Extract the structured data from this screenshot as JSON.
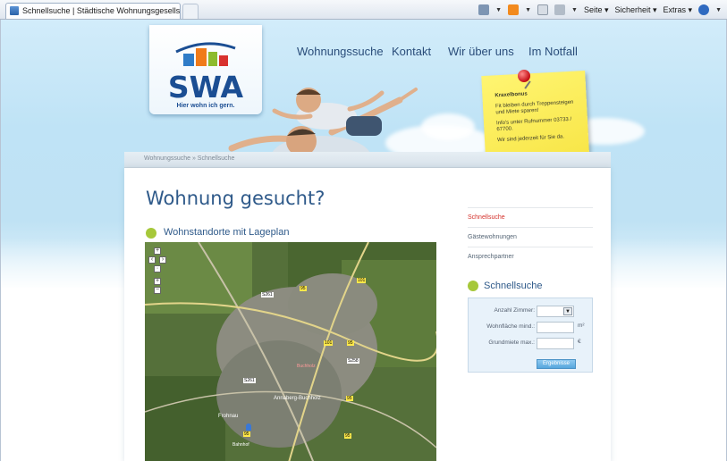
{
  "browser": {
    "tab_title": "Schnellsuche | Städtische Wohnungsgesellschaft ...",
    "tools": {
      "seite": "Seite ▾",
      "sicherheit": "Sicherheit ▾",
      "extras": "Extras ▾"
    }
  },
  "logo": {
    "text": "SWA",
    "tagline": "Hier wohn ich gern."
  },
  "nav": {
    "items": [
      {
        "label": "Wohnungssuche"
      },
      {
        "label": "Kontakt"
      },
      {
        "label": "Wir über uns"
      },
      {
        "label": "Im Notfall"
      }
    ]
  },
  "note": {
    "title": "Kraxelbonus",
    "line1": "Fit bleiben durch Treppensteigen und Miete sparen!",
    "line2": "Info's unter Rufnummer 03733 / 67700.",
    "line3": "Wir sind jederzeit für Sie da."
  },
  "breadcrumb": {
    "text": "Wohnungssuche  »  Schnellsuche"
  },
  "main": {
    "title": "Wohnung gesucht?",
    "subtitle": "Wohnstandorte mit Lageplan"
  },
  "sidebar": {
    "links": [
      {
        "label": "Schnellsuche",
        "active": true
      },
      {
        "label": "Gästewohnungen",
        "active": false
      },
      {
        "label": "Ansprechpartner",
        "active": false
      }
    ],
    "search_heading": "Schnellsuche",
    "form": {
      "zimmer_label": "Anzahl Zimmer:",
      "flaeche_label": "Wohnfläche mind.:",
      "flaeche_unit": "m²",
      "miete_label": "Grundmiete max.:",
      "miete_unit": "€",
      "button_label": "Ergebnisse"
    }
  },
  "map": {
    "road_labels": [
      "S261",
      "95",
      "101",
      "101",
      "95",
      "S258",
      "95",
      "S261",
      "95",
      "95"
    ],
    "place_labels": [
      "Annaberg-Buchholz",
      "Frohnau",
      "Buchholz",
      "Bahnhof"
    ]
  },
  "colors": {
    "accent_green": "#a6c83a",
    "heading_blue": "#2f5a8a",
    "active_red": "#d4302a",
    "note_yellow": "#fff572"
  }
}
